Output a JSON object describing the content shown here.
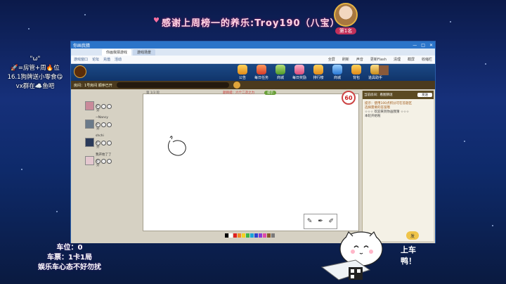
{
  "overlay": {
    "thanks": "感谢上周榜一的养乐:Troy190（八宝）",
    "rank_badge": "第1名",
    "left_note": [
      "\"ω\"",
      "🚀=房管+周🔥位",
      "16.1狗牌送小零食😋",
      "vx群在☁️鱼吧"
    ],
    "bottom_note": [
      "车位：0",
      "车票：1卡1局",
      "娱乐车心态不好勿扰"
    ],
    "go_text": [
      "上车",
      "鸭！"
    ]
  },
  "window": {
    "title": "你画我猜",
    "tabs": [
      "你画我猜游戏",
      "游戏场景"
    ],
    "toolbar_left": [
      "游戏窗口",
      "论坛",
      "充值",
      "活动"
    ],
    "toolbar_right": [
      "全屏",
      "刷新",
      "声音",
      "更新Flash",
      "清理",
      "截屏",
      "收缩栏"
    ]
  },
  "game": {
    "menu": [
      "公告",
      "每日任务",
      "商城",
      "每日奖励",
      "排行榜",
      "商城",
      "背包",
      "道具助手"
    ],
    "room_label": "房间：1号房间 顺序已开",
    "round_label": "第 1/3 轮",
    "hint_label": "题目提：六个二次之力",
    "tag": "提示",
    "timer": "60",
    "players": [
      {
        "name": "",
        "score": "0分"
      },
      {
        "name": "~Nancy",
        "score": "0分"
      },
      {
        "name": "shchi",
        "score": "0分"
      },
      {
        "name": "我开始了了",
        "score": "0分"
      }
    ],
    "chat_header": "当前房间：看图猜谜",
    "answer_button": "发送",
    "chat_messages": [
      "提示：使用100点积分可在答题区",
      "选择需要的答案哦",
      "☆☆☆ 欢迎来到你画我猜 ☆☆☆",
      "本轮开始啦"
    ],
    "brush_tools": [
      "✎",
      "✒",
      "✐"
    ],
    "ok_label": "发"
  },
  "colors": {
    "accent": "#2b74c9",
    "palette": [
      "#000000",
      "#ffffff",
      "#e02020",
      "#f08a24",
      "#f2d323",
      "#3ab54a",
      "#1aa4d8",
      "#2a44d0",
      "#8a3ad6",
      "#e04aa8",
      "#8a5a2a",
      "#7a7a7a"
    ]
  }
}
